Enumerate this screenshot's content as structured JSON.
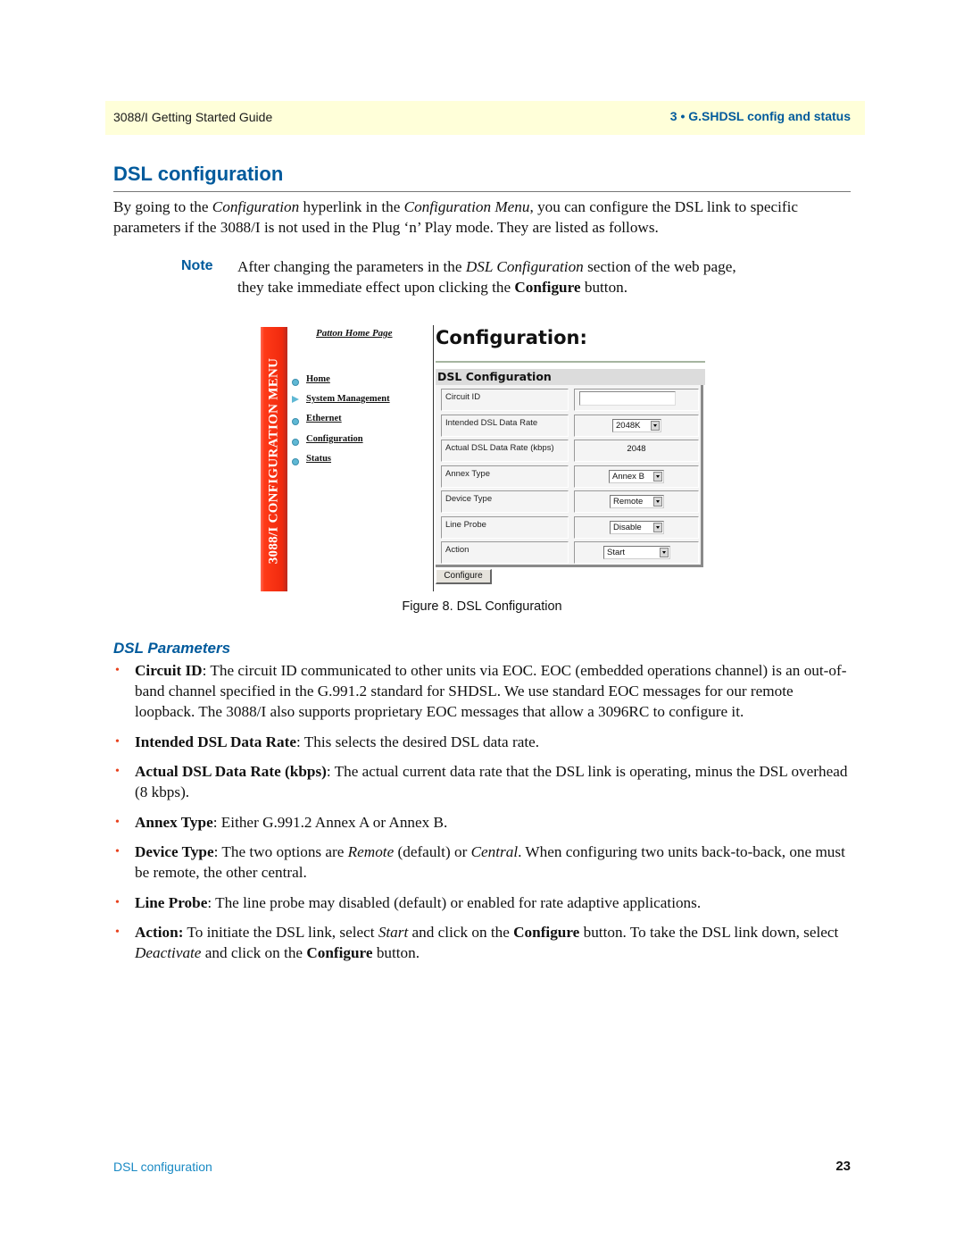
{
  "header": {
    "guide_title": "3088/I Getting Started Guide",
    "chapter": "3 • G.SHDSL config and status"
  },
  "section": {
    "title": "DSL configuration",
    "intro": [
      {
        "t": "By going to the ",
        "s": "n"
      },
      {
        "t": "Configuration",
        "s": "i"
      },
      {
        "t": " hyperlink in the ",
        "s": "n"
      },
      {
        "t": "Configuration Menu",
        "s": "i"
      },
      {
        "t": ", you can configure the DSL link to specific parameters if the 3088/I is not used in the Plug ‘n’ Play mode. They are listed as follows.",
        "s": "n"
      }
    ],
    "note_label": "Note",
    "note": [
      {
        "t": "After changing the parameters in the ",
        "s": "n"
      },
      {
        "t": "DSL Configuration",
        "s": "i"
      },
      {
        "t": " section of the web page, they take immediate effect upon clicking the ",
        "s": "n"
      },
      {
        "t": "Configure",
        "s": "b"
      },
      {
        "t": " button.",
        "s": "n"
      }
    ]
  },
  "figure": {
    "sidebar_title": "3088/I CONFIGURATION MENU",
    "home_link": "Patton Home Page",
    "menu": [
      {
        "label": "Home",
        "icon": "circle"
      },
      {
        "label": "System Management",
        "icon": "triangle"
      },
      {
        "label": "Ethernet",
        "icon": "circle"
      },
      {
        "label": "Configuration",
        "icon": "circle"
      },
      {
        "label": "Status",
        "icon": "circle"
      }
    ],
    "page_title": "Configuration:",
    "section_title": "DSL Configuration",
    "rows": [
      {
        "label": "Circuit ID",
        "type": "text",
        "value": ""
      },
      {
        "label": "Intended DSL Data Rate",
        "type": "select",
        "value": "2048K"
      },
      {
        "label": "Actual DSL Data Rate (kbps)",
        "type": "readonly",
        "value": "2048"
      },
      {
        "label": "Annex Type",
        "type": "select",
        "value": "Annex B"
      },
      {
        "label": "Device Type",
        "type": "select",
        "value": "Remote"
      },
      {
        "label": "Line Probe",
        "type": "select",
        "value": "Disable"
      },
      {
        "label": "Action",
        "type": "select",
        "value": "Start"
      }
    ],
    "button_label": "Configure",
    "caption": "Figure 8. DSL Configuration"
  },
  "parameters": {
    "title": "DSL Parameters",
    "items": [
      [
        {
          "t": "Circuit ID",
          "s": "b"
        },
        {
          "t": ": The circuit ID communicated to other units via EOC. EOC (embedded operations channel) is an out-of-band channel specified in the G.991.2 standard for SHDSL. We use standard EOC messages for our remote loopback. The 3088/I also supports proprietary EOC messages that allow a 3096RC to configure it.",
          "s": "n"
        }
      ],
      [
        {
          "t": "Intended DSL Data Rate",
          "s": "b"
        },
        {
          "t": ": This selects the desired DSL data rate.",
          "s": "n"
        }
      ],
      [
        {
          "t": "Actual DSL Data Rate (kbps)",
          "s": "b"
        },
        {
          "t": ": The actual current data rate that the DSL link is operating, minus the DSL overhead (8 kbps).",
          "s": "n"
        }
      ],
      [
        {
          "t": "Annex Type",
          "s": "b"
        },
        {
          "t": ": Either G.991.2 Annex A or Annex B.",
          "s": "n"
        }
      ],
      [
        {
          "t": "Device Type",
          "s": "b"
        },
        {
          "t": ": The two options are ",
          "s": "n"
        },
        {
          "t": "Remote",
          "s": "i"
        },
        {
          "t": " (default) or ",
          "s": "n"
        },
        {
          "t": "Central",
          "s": "i"
        },
        {
          "t": ". When configuring two units back-to-back, one must be remote, the other central.",
          "s": "n"
        }
      ],
      [
        {
          "t": "Line Probe",
          "s": "b"
        },
        {
          "t": ": The line probe may disabled (default) or enabled for rate adaptive applications.",
          "s": "n"
        }
      ],
      [
        {
          "t": "Action:",
          "s": "b"
        },
        {
          "t": " To initiate the DSL link, select ",
          "s": "n"
        },
        {
          "t": "Start",
          "s": "i"
        },
        {
          "t": " and click on the ",
          "s": "n"
        },
        {
          "t": "Configure",
          "s": "b"
        },
        {
          "t": " button. To take the DSL link down, select ",
          "s": "n"
        },
        {
          "t": "Deactivate",
          "s": "i"
        },
        {
          "t": " and click on the ",
          "s": "n"
        },
        {
          "t": "Configure",
          "s": "b"
        },
        {
          "t": " button.",
          "s": "n"
        }
      ]
    ]
  },
  "footer": {
    "section_name": "DSL configuration",
    "page_number": "23"
  },
  "colors": {
    "accent_blue": "#005a9c",
    "bullet_red": "#e8401c",
    "header_band": "#ffffd9",
    "menu_red": "#f02a0e"
  }
}
